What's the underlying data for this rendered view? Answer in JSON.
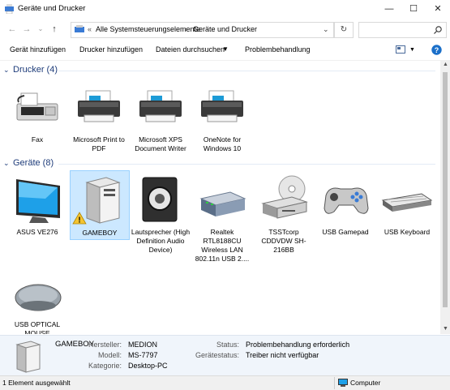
{
  "window": {
    "title": "Geräte und Drucker"
  },
  "address": {
    "prefix": "«",
    "crumb1": "Alle Systemsteuerungselemente",
    "separator": "›",
    "crumb2": "Geräte und Drucker"
  },
  "toolbar": {
    "add_device": "Gerät hinzufügen",
    "add_printer": "Drucker hinzufügen",
    "browse_files": "Dateien durchsuchen",
    "troubleshoot": "Problembehandlung"
  },
  "groups": {
    "printers": {
      "header": "Drucker (4)",
      "items": [
        "Fax",
        "Microsoft Print to PDF",
        "Microsoft XPS Document Writer",
        "OneNote for Windows 10"
      ]
    },
    "devices": {
      "header": "Geräte (8)",
      "items": [
        "ASUS VE276",
        "GAMEBOY",
        "Lautsprecher (High Definition Audio Device)",
        "Realtek RTL8188CU Wireless LAN 802.11n USB 2....",
        "TSSTcorp CDDVDW SH-216BB",
        "USB Gamepad",
        "USB Keyboard",
        "USB OPTICAL MOUSE"
      ]
    }
  },
  "details": {
    "name": "GAMEBOY",
    "manufacturer_label": "Hersteller:",
    "manufacturer": "MEDION",
    "model_label": "Modell:",
    "model": "MS-7797",
    "category_label": "Kategorie:",
    "category": "Desktop-PC",
    "status_label": "Status:",
    "status": "Problembehandlung erforderlich",
    "driver_label": "Gerätestatus:",
    "driver": "Treiber nicht verfügbar"
  },
  "statusbar": {
    "selection": "1 Element ausgewählt",
    "computer": "Computer"
  },
  "colors": {
    "group_header": "#1e3c7a",
    "selection_bg": "#cce8ff",
    "help": "#1a6fc9"
  }
}
